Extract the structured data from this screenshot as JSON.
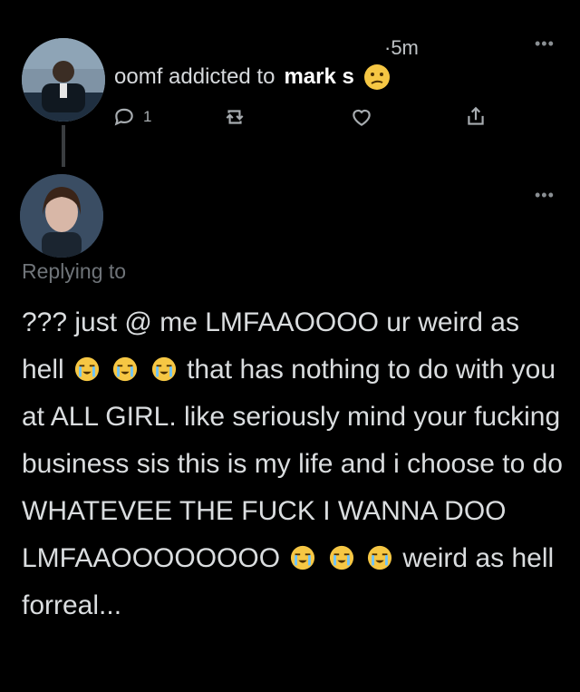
{
  "tweet": {
    "time": "·5m",
    "author_prefix": "oomf addicted to",
    "author_bold": "mark s",
    "reply_count": "1",
    "icons": [
      "reply-icon",
      "retweet-icon",
      "like-icon",
      "share-icon"
    ]
  },
  "reply": {
    "replying_to": "Replying to",
    "text_parts": [
      "??? just @ me LMFAAOOOO ur weird as hell ",
      " that has nothing to do with you at ALL GIRL. like seriously mind your fucking business sis this is my life and i choose to do WHATEVEE THE FUCK I WANNA DOO LMFAAOOOOOOOO",
      " weird as hell forreal..."
    ]
  },
  "colors": {
    "bg": "#000000",
    "text": "#dadddf",
    "muted": "#6f7479",
    "icon": "#a7acb0"
  }
}
